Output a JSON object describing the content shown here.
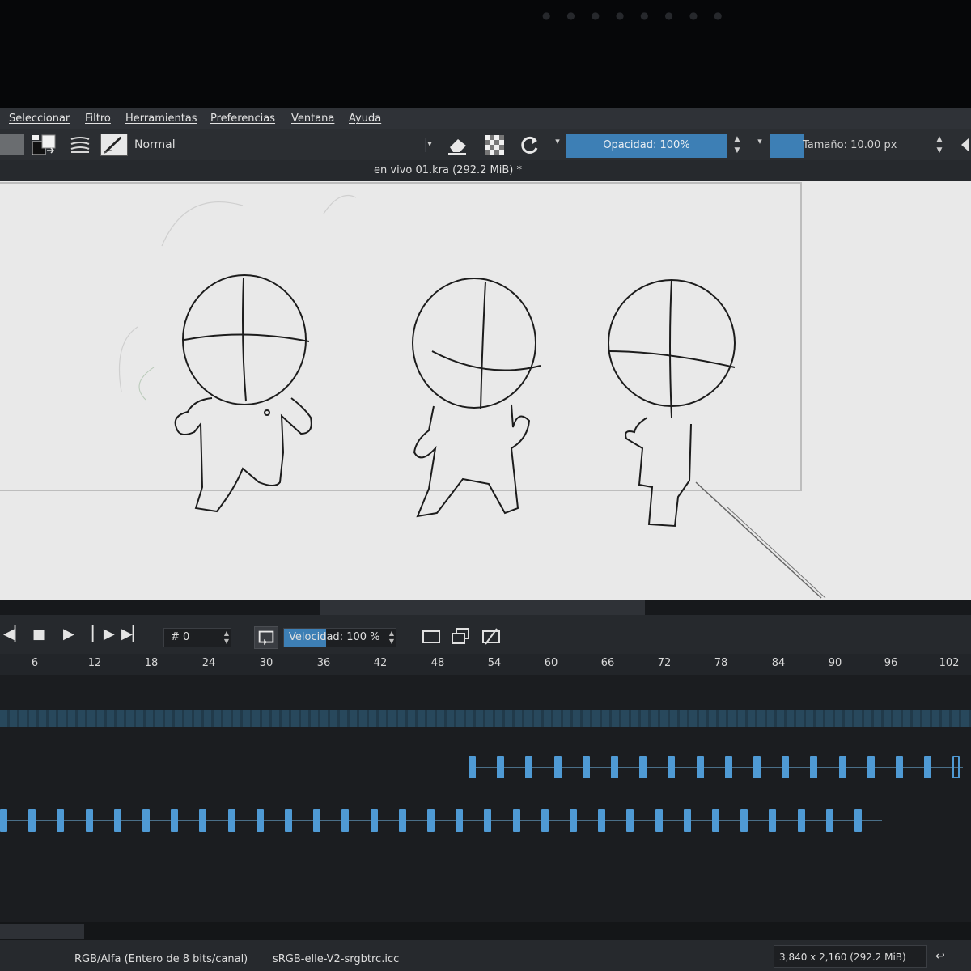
{
  "menu": {
    "items": [
      "Seleccionar",
      "Filtro",
      "Herramientas",
      "Preferencias",
      "Ventana",
      "Ayuda"
    ]
  },
  "toolbar": {
    "blend_mode": "Normal",
    "opacity_label": "Opacidad: 100%",
    "size_label": "Tamaño: 10.00 px"
  },
  "document": {
    "title": "en vivo 01.kra (292.2 MiB)  *"
  },
  "transport": {
    "frame_value": "# 0",
    "speed_prefix": "Velocidad",
    "speed_value": ": 100 %"
  },
  "ruler": {
    "ticks": [
      "6",
      "12",
      "18",
      "24",
      "30",
      "36",
      "42",
      "48",
      "54",
      "60",
      "66",
      "72",
      "78",
      "84",
      "90",
      "96",
      "102"
    ]
  },
  "status": {
    "color_model": "RGB/Alfa (Entero de 8 bits/canal)",
    "color_profile": "sRGB-elle-V2-srgbtrc.icc",
    "dimensions": "3,840 x 2,160 (292.2 MiB)"
  },
  "colors": {
    "accent": "#3d7fb5",
    "keyframe": "#4f9ad4",
    "panel": "#2b2e32",
    "canvas": "#e9e9e9"
  },
  "icons": {
    "eraser": "eraser-icon",
    "alpha": "alpha-lock-icon",
    "reload": "reload-preset-icon",
    "loop": "loop-icon"
  }
}
